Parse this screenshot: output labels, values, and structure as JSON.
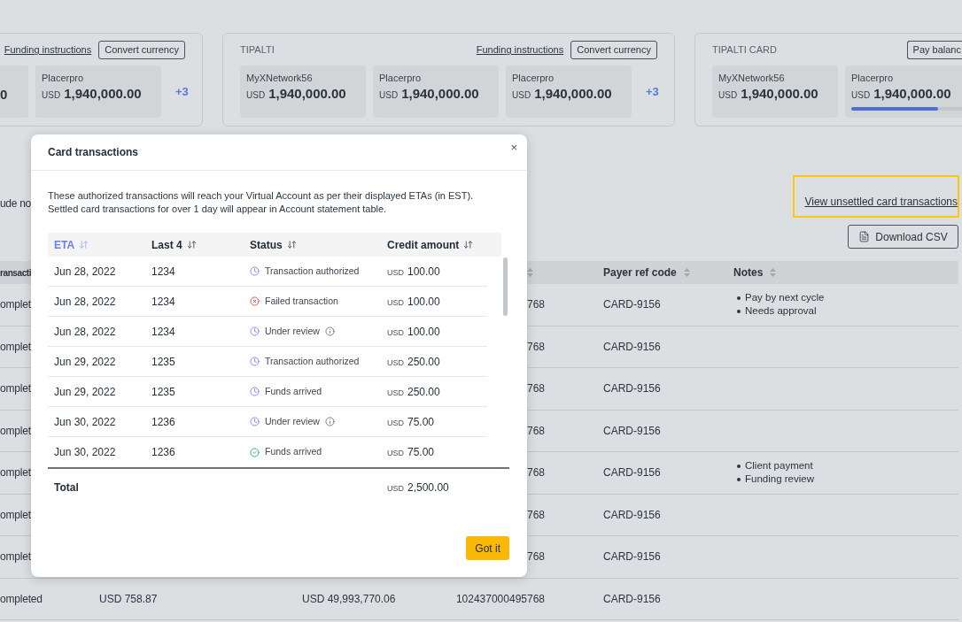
{
  "account_cards": [
    {
      "kind": "cut_left",
      "link": "Funding instructions",
      "button": "Convert currency",
      "balances": [
        {
          "kind": "cut_left",
          "amount": "0"
        },
        {
          "kind": "full",
          "name": "Placerpro",
          "currency": "USD",
          "amount": "1,940,000.00"
        }
      ],
      "more": "+3"
    },
    {
      "kind": "full",
      "title": "TIPALTI",
      "link": "Funding instructions",
      "button": "Convert currency",
      "balances": [
        {
          "kind": "full",
          "name": "MyXNetwork56",
          "currency": "USD",
          "amount": "1,940,000.00"
        },
        {
          "kind": "full",
          "name": "Placerpro",
          "currency": "USD",
          "amount": "1,940,000.00"
        },
        {
          "kind": "full",
          "name": "Placerpro",
          "currency": "USD",
          "amount": "1,940,000.00"
        }
      ],
      "more": "+3"
    },
    {
      "kind": "cut_right",
      "title": "TIPALTI CARD",
      "button": "Pay balanc",
      "balances": [
        {
          "kind": "full",
          "name": "MyXNetwork56",
          "currency": "USD",
          "amount": "1,940,000.00"
        },
        {
          "kind": "cut_right",
          "name": "Placerpro",
          "currency": "USD",
          "amount": "1,940,000.00",
          "level": 0.78
        }
      ]
    }
  ],
  "filter_text": "ude no",
  "unsettled_link": "View unsettled card transactions",
  "download_button": "Download CSV",
  "statement_table": {
    "columns": {
      "column_1": "ransacti",
      "payer_ref_code": "Payer ref code",
      "notes": "Notes"
    },
    "rows": [
      {
        "column_1": "omplet",
        "column_4": "768",
        "payer_ref_code": "CARD-9156",
        "notes": [
          "Pay by next cycle",
          "Needs approval"
        ]
      },
      {
        "column_1": "omplet",
        "column_4": "768",
        "payer_ref_code": "CARD-9156"
      },
      {
        "column_1": "omplet",
        "column_4": "768",
        "payer_ref_code": "CARD-9156"
      },
      {
        "column_1": "omplet",
        "column_4": "768",
        "payer_ref_code": "CARD-9156"
      },
      {
        "column_1": "omplet",
        "column_4": "768",
        "payer_ref_code": "CARD-9156",
        "notes": [
          "Client payment",
          "Funding review"
        ]
      },
      {
        "column_1": "omplet",
        "column_4": "768",
        "payer_ref_code": "CARD-9156"
      },
      {
        "column_1": "omplet",
        "column_4": "768",
        "payer_ref_code": "CARD-9156"
      },
      {
        "column_1": "ompleted",
        "column_2": "USD 758.87",
        "column_3": "USD 49,993,770.06",
        "column_4": "102437000495768",
        "payer_ref_code": "CARD-9156"
      }
    ]
  },
  "card_transactions_modal": {
    "title": "Card transactions",
    "close": "×",
    "description": [
      "These authorized transactions will reach your Virtual Account as per their displayed ETAs (in EST).",
      "Settled card transactions for over 1 day will appear in Account statement table."
    ],
    "columns": [
      {
        "label": "ETA",
        "selected": true
      },
      {
        "label": "Last 4",
        "selected": false
      },
      {
        "label": "Status",
        "selected": false
      },
      {
        "label": "Credit amount",
        "selected": false
      }
    ],
    "rows": [
      {
        "eta": "Jun 28, 2022",
        "last_4": "1234",
        "status": "Transaction authorized",
        "kind": "pending",
        "info": false,
        "currency": "USD",
        "amount": "100.00"
      },
      {
        "eta": "Jun 28, 2022",
        "last_4": "1234",
        "status": "Failed transaction",
        "kind": "failed",
        "info": false,
        "currency": "USD",
        "amount": "100.00"
      },
      {
        "eta": "Jun 28, 2022",
        "last_4": "1234",
        "status": "Under review",
        "kind": "pending",
        "info": true,
        "currency": "USD",
        "amount": "100.00"
      },
      {
        "eta": "Jun 29, 2022",
        "last_4": "1235",
        "status": "Transaction authorized",
        "kind": "pending",
        "info": false,
        "currency": "USD",
        "amount": "250.00"
      },
      {
        "eta": "Jun 29, 2022",
        "last_4": "1235",
        "status": "Funds arrived",
        "kind": "pending",
        "info": false,
        "currency": "USD",
        "amount": "250.00"
      },
      {
        "eta": "Jun 30, 2022",
        "last_4": "1236",
        "status": "Under review",
        "kind": "pending",
        "info": true,
        "currency": "USD",
        "amount": "75.00"
      },
      {
        "eta": "Jun 30, 2022",
        "last_4": "1236",
        "status": "Funds arrived",
        "kind": "complete",
        "info": false,
        "currency": "USD",
        "amount": "75.00"
      }
    ],
    "total": {
      "label": "Total",
      "currency": "USD",
      "amount": "2,500.00"
    },
    "confirm_button": "Got it"
  }
}
